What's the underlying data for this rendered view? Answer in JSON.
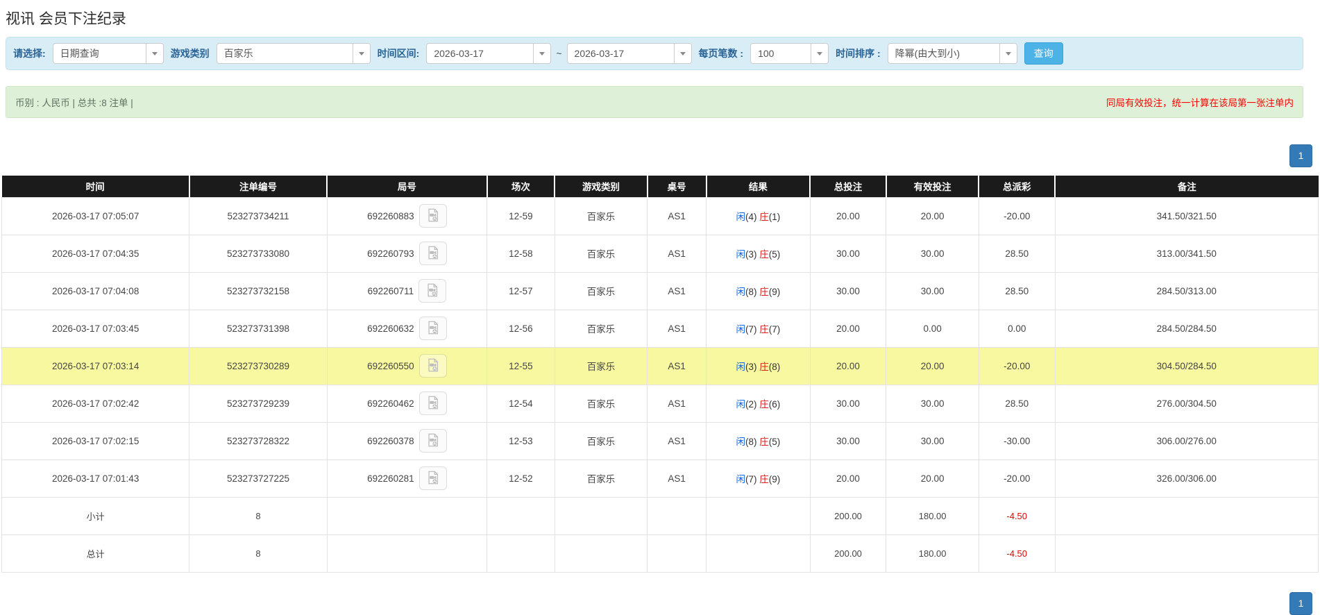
{
  "page": {
    "title": "视讯 会员下注纪录"
  },
  "filters": {
    "select": {
      "label": "请选择:",
      "value": "日期查询"
    },
    "game_type": {
      "label": "游戏类别",
      "value": "百家乐"
    },
    "time_range": {
      "label": "时间区间:",
      "from": "2026-03-17",
      "separator": "~",
      "to": "2026-03-17"
    },
    "page_size": {
      "label": "每页笔数 :",
      "value": "100"
    },
    "sort": {
      "label": "时间排序 :",
      "value": "降幂(由大到小)"
    },
    "query_button": "查询"
  },
  "info_bar": {
    "summary": "币别 : 人民币 | 总共 :8 注单 |",
    "notice": "同局有效投注，统一计算在该局第一张注单内"
  },
  "pagination": {
    "page": "1"
  },
  "table": {
    "headers": [
      "时间",
      "注单编号",
      "局号",
      "场次",
      "游戏类别",
      "桌号",
      "结果",
      "总投注",
      "有效投注",
      "总派彩",
      "备注"
    ],
    "rows": [
      {
        "time": "2026-03-17 07:05:07",
        "bet_id": "523273734211",
        "round_id": "692260883",
        "session": "12-59",
        "game": "百家乐",
        "table_no": "AS1",
        "result": {
          "p_label": "闲",
          "p_num": "(4)",
          "b_label": "庄",
          "b_num": "(1)"
        },
        "total_bet": "20.00",
        "valid_bet": "20.00",
        "payout": "-20.00",
        "remark": "341.50/321.50",
        "highlight": false
      },
      {
        "time": "2026-03-17 07:04:35",
        "bet_id": "523273733080",
        "round_id": "692260793",
        "session": "12-58",
        "game": "百家乐",
        "table_no": "AS1",
        "result": {
          "p_label": "闲",
          "p_num": "(3)",
          "b_label": "庄",
          "b_num": "(5)"
        },
        "total_bet": "30.00",
        "valid_bet": "30.00",
        "payout": "28.50",
        "remark": "313.00/341.50",
        "highlight": false
      },
      {
        "time": "2026-03-17 07:04:08",
        "bet_id": "523273732158",
        "round_id": "692260711",
        "session": "12-57",
        "game": "百家乐",
        "table_no": "AS1",
        "result": {
          "p_label": "闲",
          "p_num": "(8)",
          "b_label": "庄",
          "b_num": "(9)"
        },
        "total_bet": "30.00",
        "valid_bet": "30.00",
        "payout": "28.50",
        "remark": "284.50/313.00",
        "highlight": false
      },
      {
        "time": "2026-03-17 07:03:45",
        "bet_id": "523273731398",
        "round_id": "692260632",
        "session": "12-56",
        "game": "百家乐",
        "table_no": "AS1",
        "result": {
          "p_label": "闲",
          "p_num": "(7)",
          "b_label": "庄",
          "b_num": "(7)"
        },
        "total_bet": "20.00",
        "valid_bet": "0.00",
        "payout": "0.00",
        "remark": "284.50/284.50",
        "highlight": false
      },
      {
        "time": "2026-03-17 07:03:14",
        "bet_id": "523273730289",
        "round_id": "692260550",
        "session": "12-55",
        "game": "百家乐",
        "table_no": "AS1",
        "result": {
          "p_label": "闲",
          "p_num": "(3)",
          "b_label": "庄",
          "b_num": "(8)"
        },
        "total_bet": "20.00",
        "valid_bet": "20.00",
        "payout": "-20.00",
        "remark": "304.50/284.50",
        "highlight": true
      },
      {
        "time": "2026-03-17 07:02:42",
        "bet_id": "523273729239",
        "round_id": "692260462",
        "session": "12-54",
        "game": "百家乐",
        "table_no": "AS1",
        "result": {
          "p_label": "闲",
          "p_num": "(2)",
          "b_label": "庄",
          "b_num": "(6)"
        },
        "total_bet": "30.00",
        "valid_bet": "30.00",
        "payout": "28.50",
        "remark": "276.00/304.50",
        "highlight": false
      },
      {
        "time": "2026-03-17 07:02:15",
        "bet_id": "523273728322",
        "round_id": "692260378",
        "session": "12-53",
        "game": "百家乐",
        "table_no": "AS1",
        "result": {
          "p_label": "闲",
          "p_num": "(8)",
          "b_label": "庄",
          "b_num": "(5)"
        },
        "total_bet": "30.00",
        "valid_bet": "30.00",
        "payout": "-30.00",
        "remark": "306.00/276.00",
        "highlight": false
      },
      {
        "time": "2026-03-17 07:01:43",
        "bet_id": "523273727225",
        "round_id": "692260281",
        "session": "12-52",
        "game": "百家乐",
        "table_no": "AS1",
        "result": {
          "p_label": "闲",
          "p_num": "(7)",
          "b_label": "庄",
          "b_num": "(9)"
        },
        "total_bet": "20.00",
        "valid_bet": "20.00",
        "payout": "-20.00",
        "remark": "326.00/306.00",
        "highlight": false
      }
    ],
    "subtotal": {
      "label": "小计",
      "count": "8",
      "total_bet": "200.00",
      "valid_bet": "180.00",
      "payout": "-4.50"
    },
    "total": {
      "label": "总计",
      "count": "8",
      "total_bet": "200.00",
      "valid_bet": "180.00",
      "payout": "-4.50"
    }
  },
  "icons": {
    "video_replay": "video-replay-icon",
    "dropdown_caret": "chevron-down-icon"
  },
  "colors": {
    "query_button": "#4db3e6",
    "pagination_button": "#337ab7",
    "highlight_row": "#f8f8a0",
    "link_blue": "#1266e3",
    "negative_red": "#e60000",
    "player_blue": "#1266e3",
    "banker_red": "#e01b1b",
    "header_bg": "#1b1b1b",
    "totals_bg": "#9c9c9c",
    "filter_bar_bg": "#d9edf7",
    "info_bar_bg": "#dff0d8",
    "notice_red": "#ff0000",
    "label_blue": "#2a6496"
  }
}
